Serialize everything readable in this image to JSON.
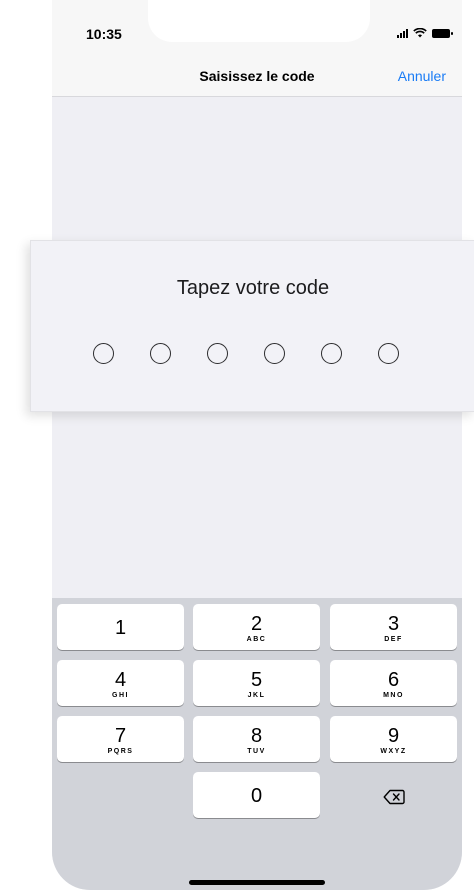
{
  "status": {
    "time": "10:35"
  },
  "nav": {
    "title": "Saisissez le code",
    "cancel": "Annuler"
  },
  "code": {
    "title": "Tapez votre code",
    "length": 6,
    "filled": 0
  },
  "keypad": {
    "keys": [
      {
        "digit": "1",
        "letters": ""
      },
      {
        "digit": "2",
        "letters": "ABC"
      },
      {
        "digit": "3",
        "letters": "DEF"
      },
      {
        "digit": "4",
        "letters": "GHI"
      },
      {
        "digit": "5",
        "letters": "JKL"
      },
      {
        "digit": "6",
        "letters": "MNO"
      },
      {
        "digit": "7",
        "letters": "PQRS"
      },
      {
        "digit": "8",
        "letters": "TUV"
      },
      {
        "digit": "9",
        "letters": "WXYZ"
      },
      {
        "digit": "0",
        "letters": ""
      }
    ],
    "delete_icon": "backspace-icon"
  }
}
